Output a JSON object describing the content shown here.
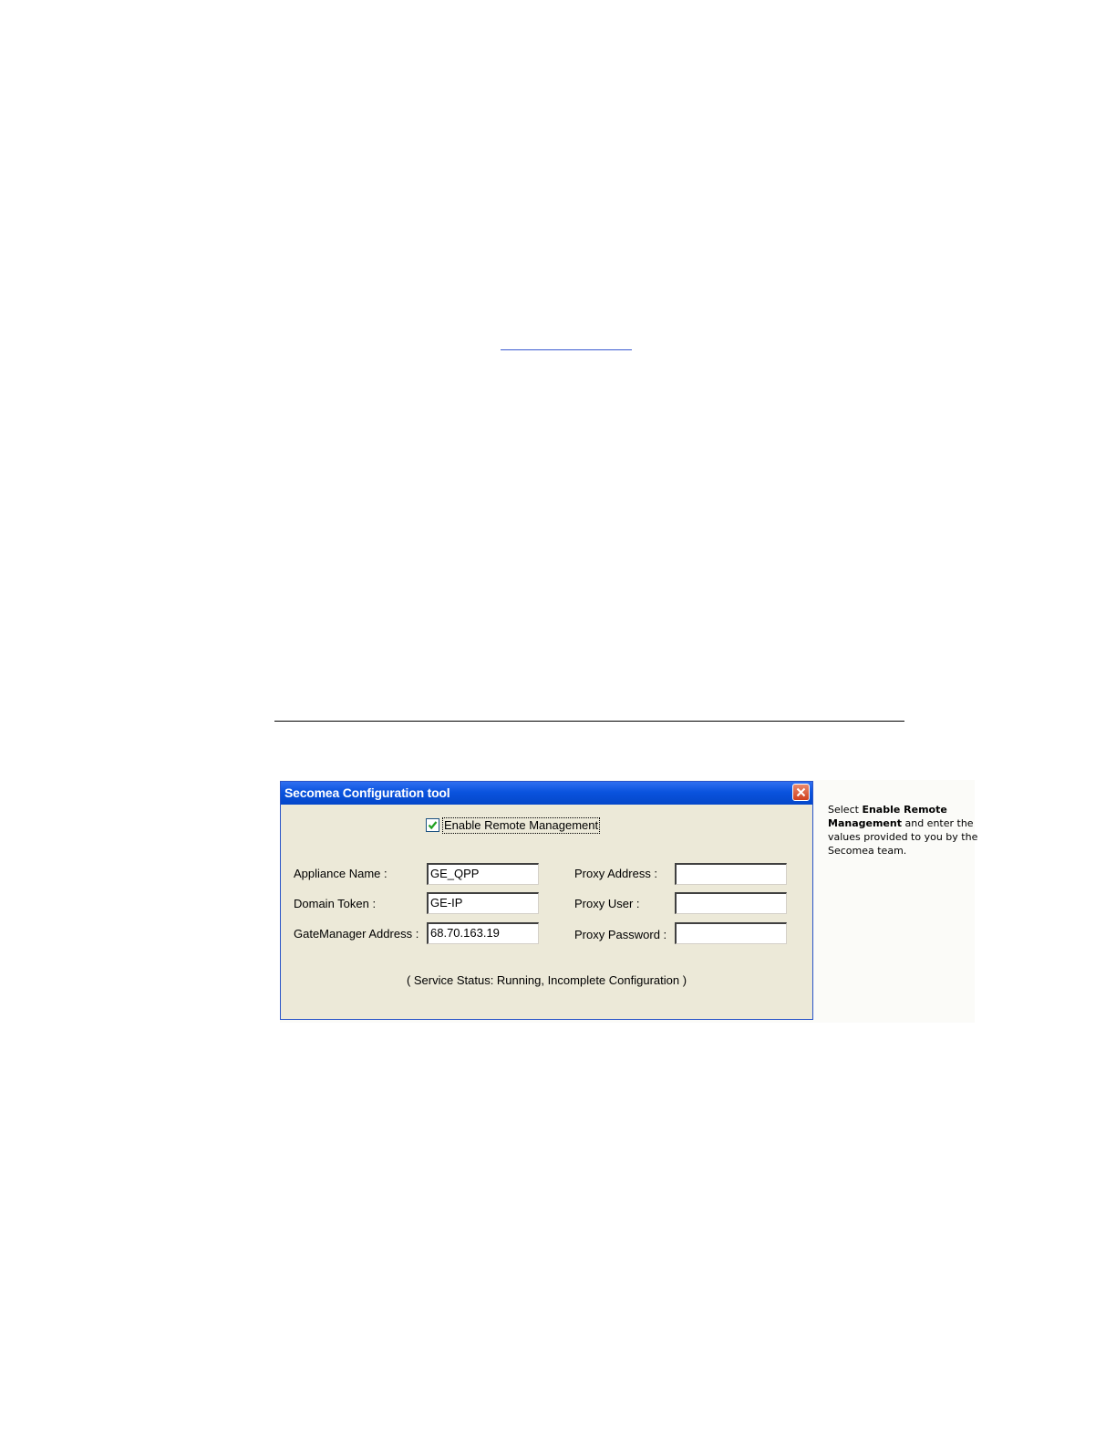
{
  "dialog": {
    "title": "Secomea Configuration tool",
    "close_icon": "close-icon",
    "enable_remote_management": {
      "label": "Enable Remote Management",
      "checked": true
    },
    "fields_left": [
      {
        "label": "Appliance Name :",
        "value": "GE_QPP"
      },
      {
        "label": "Domain Token :",
        "value": "GE-IP"
      },
      {
        "label": "GateManager Address :",
        "value": "68.70.163.19"
      }
    ],
    "fields_right": [
      {
        "label": "Proxy Address :",
        "value": ""
      },
      {
        "label": "Proxy User :",
        "value": ""
      },
      {
        "label": "Proxy Password :",
        "value": ""
      }
    ],
    "status": "( Service Status: Running, Incomplete Configuration )"
  },
  "callout": {
    "prefix": "Select ",
    "bold": "Enable Remote Management",
    "suffix": " and enter the values provided to you by the Secomea team."
  },
  "colors": {
    "titlebar": "#0a53de",
    "dialog_bg": "#ece9d8",
    "close_button": "#d0401e",
    "checkmark": "#21a121",
    "link_underline": "#3a5bd1"
  }
}
